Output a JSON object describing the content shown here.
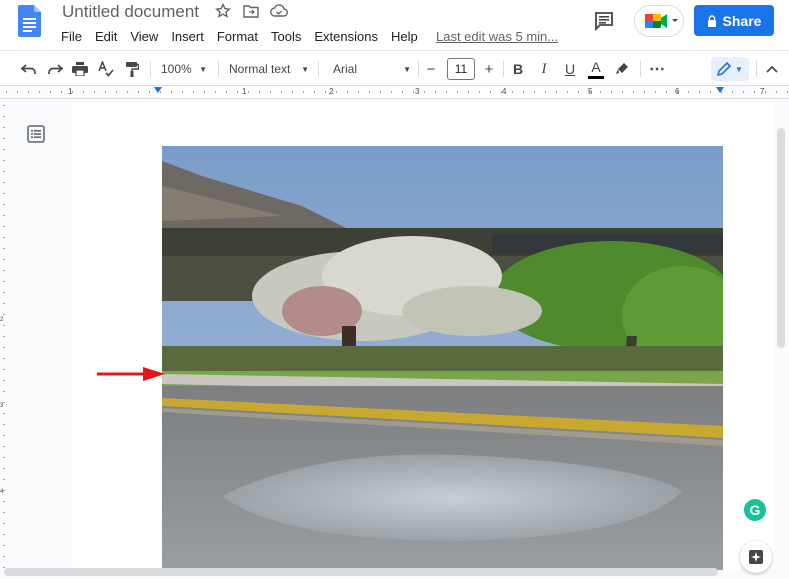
{
  "doc": {
    "title": "Untitled document"
  },
  "menu": {
    "items": [
      "File",
      "Edit",
      "View",
      "Insert",
      "Format",
      "Tools",
      "Extensions",
      "Help"
    ],
    "last_edit": "Last edit was 5 min..."
  },
  "header": {
    "share_label": "Share"
  },
  "toolbar": {
    "zoom": "100%",
    "style": "Normal text",
    "font": "Arial",
    "font_size": "11",
    "minus": "−",
    "plus": "+",
    "bold": "B",
    "italic": "I",
    "underline": "U",
    "text_color": "A",
    "more": "⋯"
  },
  "ruler": {
    "labels": [
      "1",
      "1",
      "2",
      "3",
      "4",
      "5",
      "6",
      "7"
    ]
  },
  "vruler": {
    "labels": [
      "1",
      "2",
      "3",
      "4"
    ]
  },
  "colors": {
    "accent": "#1a73e8",
    "arrow": "#e8141c",
    "grammarly": "#15c39a"
  },
  "icons": [
    "docs-logo-icon",
    "star-icon",
    "move-folder-icon",
    "cloud-saved-icon",
    "comment-icon",
    "meet-icon",
    "lock-icon",
    "undo-icon",
    "redo-icon",
    "print-icon",
    "spellcheck-icon",
    "paint-format-icon",
    "highlighter-icon",
    "pencil-icon",
    "chevron-up-icon",
    "outline-icon",
    "grammarly-icon",
    "explore-icon"
  ]
}
